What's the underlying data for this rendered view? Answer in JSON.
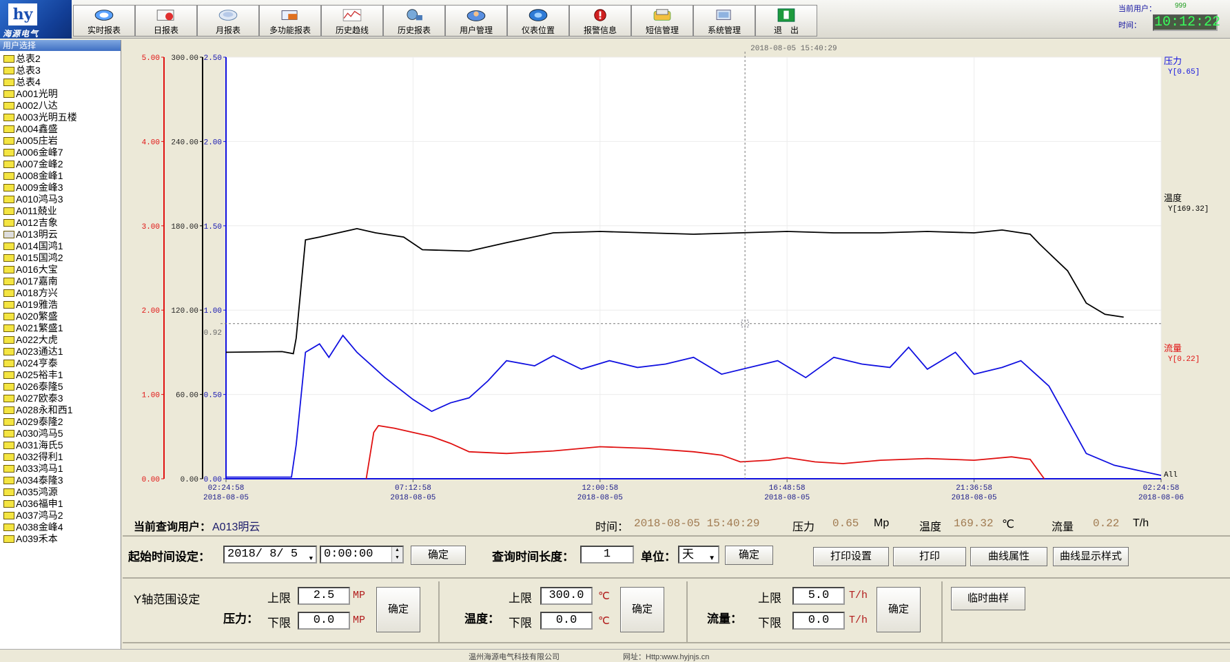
{
  "logo": {
    "mark": "hy",
    "name": "海源电气"
  },
  "toolbar": {
    "buttons": [
      {
        "label": "实时报表",
        "icon": "realtime-report-icon"
      },
      {
        "label": "日报表",
        "icon": "daily-report-icon"
      },
      {
        "label": "月报表",
        "icon": "monthly-report-icon"
      },
      {
        "label": "多功能报表",
        "icon": "multi-report-icon"
      },
      {
        "label": "历史趋线",
        "icon": "history-trend-icon"
      },
      {
        "label": "历史报表",
        "icon": "history-report-icon"
      },
      {
        "label": "用户管理",
        "icon": "user-manage-icon"
      },
      {
        "label": "仪表位置",
        "icon": "meter-location-icon"
      },
      {
        "label": "报警信息",
        "icon": "alarm-icon"
      },
      {
        "label": "短信管理",
        "icon": "sms-icon"
      },
      {
        "label": "系统管理",
        "icon": "system-icon"
      },
      {
        "label": "退　出",
        "icon": "exit-icon"
      }
    ]
  },
  "userinfo": {
    "current_user_label": "当前用户：",
    "current_user_value": "999",
    "time_label": "时间：",
    "time_value": "10:12:22"
  },
  "sidebar": {
    "header": "用户选择",
    "items": [
      "总表2",
      "总表3",
      "总表4",
      "A001光明",
      "A002八达",
      "A003光明五楼",
      "A004鑫盛",
      "A005庄岩",
      "A006金峰7",
      "A007金峰2",
      "A008金峰1",
      "A009金峰3",
      "A010鸿马3",
      "A011兢业",
      "A012吉象",
      "A013明云",
      "A014国鸿1",
      "A015国鸿2",
      "A016大宝",
      "A017嘉南",
      "A018方兴",
      "A019雅浩",
      "A020繁盛",
      "A021繁盛1",
      "A022大虎",
      "A023通达1",
      "A024亨泰",
      "A025裕丰1",
      "A026泰隆5",
      "A027欧泰3",
      "A028永和西1",
      "A029泰隆2",
      "A030鸿马5",
      "A031海氏5",
      "A032得利1",
      "A033鸿马1",
      "A034泰隆3",
      "A035鸿源",
      "A036福申1",
      "A037鸿马2",
      "A038金峰4",
      "A039禾本"
    ],
    "selected_index": 15
  },
  "chart_data": {
    "type": "line",
    "x": [
      "02:24:58",
      "07:12:58",
      "12:00:58",
      "16:48:58",
      "21:36:58",
      "02:24:58"
    ],
    "x_dates": [
      "2018-08-05",
      "2018-08-05",
      "2018-08-05",
      "2018-08-05",
      "2018-08-05",
      "2018-08-06"
    ],
    "cursor_label": "2018-08-05 15:40:29",
    "cursor_y_label": "0.92",
    "axes": [
      {
        "name": "流量",
        "color": "#e01010",
        "ylim": [
          0,
          5
        ],
        "ticks": [
          "0.00",
          "1.00",
          "2.00",
          "3.00",
          "4.00",
          "5.00"
        ]
      },
      {
        "name": "温度",
        "color": "#000000",
        "ylim": [
          0,
          300
        ],
        "ticks": [
          "0.00",
          "60.00",
          "120.00",
          "180.00",
          "240.00",
          "300.00"
        ]
      },
      {
        "name": "压力",
        "color": "#1010e0",
        "ylim": [
          0,
          2.5
        ],
        "ticks": [
          "0.00",
          "0.50",
          "1.00",
          "1.50",
          "2.00",
          "2.50"
        ]
      }
    ],
    "labels": {
      "pressure": "压力",
      "pressure_y": "Y[0.65]",
      "temperature": "温度",
      "temperature_y": "Y[169.32]",
      "flow": "流量",
      "flow_y": "Y[0.22]",
      "all": "All"
    },
    "series": [
      {
        "name": "温度",
        "color": "#000000",
        "axis": 1,
        "points": [
          [
            0,
            90
          ],
          [
            0.06,
            90.5
          ],
          [
            0.072,
            89
          ],
          [
            0.075,
            100
          ],
          [
            0.085,
            170
          ],
          [
            0.1,
            172
          ],
          [
            0.12,
            175
          ],
          [
            0.14,
            178
          ],
          [
            0.16,
            175
          ],
          [
            0.19,
            172
          ],
          [
            0.21,
            163
          ],
          [
            0.26,
            162
          ],
          [
            0.3,
            168
          ],
          [
            0.35,
            175
          ],
          [
            0.4,
            176
          ],
          [
            0.45,
            175
          ],
          [
            0.5,
            174
          ],
          [
            0.55,
            175
          ],
          [
            0.6,
            176
          ],
          [
            0.65,
            175
          ],
          [
            0.7,
            175
          ],
          [
            0.75,
            176
          ],
          [
            0.8,
            175
          ],
          [
            0.83,
            177
          ],
          [
            0.86,
            174
          ],
          [
            0.87,
            167
          ],
          [
            0.9,
            148
          ],
          [
            0.92,
            125
          ],
          [
            0.94,
            117
          ],
          [
            0.96,
            115
          ]
        ]
      },
      {
        "name": "压力",
        "color": "#1010e0",
        "axis": 2,
        "points": [
          [
            0,
            0.01
          ],
          [
            0.07,
            0.01
          ],
          [
            0.075,
            0.2
          ],
          [
            0.085,
            0.75
          ],
          [
            0.1,
            0.8
          ],
          [
            0.11,
            0.72
          ],
          [
            0.125,
            0.85
          ],
          [
            0.14,
            0.75
          ],
          [
            0.17,
            0.6
          ],
          [
            0.2,
            0.47
          ],
          [
            0.22,
            0.4
          ],
          [
            0.24,
            0.45
          ],
          [
            0.26,
            0.48
          ],
          [
            0.28,
            0.58
          ],
          [
            0.3,
            0.7
          ],
          [
            0.33,
            0.67
          ],
          [
            0.35,
            0.73
          ],
          [
            0.38,
            0.65
          ],
          [
            0.41,
            0.7
          ],
          [
            0.44,
            0.66
          ],
          [
            0.47,
            0.68
          ],
          [
            0.5,
            0.72
          ],
          [
            0.53,
            0.62
          ],
          [
            0.56,
            0.66
          ],
          [
            0.59,
            0.7
          ],
          [
            0.62,
            0.6
          ],
          [
            0.65,
            0.72
          ],
          [
            0.68,
            0.68
          ],
          [
            0.71,
            0.66
          ],
          [
            0.73,
            0.78
          ],
          [
            0.75,
            0.65
          ],
          [
            0.78,
            0.75
          ],
          [
            0.8,
            0.62
          ],
          [
            0.83,
            0.66
          ],
          [
            0.85,
            0.7
          ],
          [
            0.87,
            0.6
          ],
          [
            0.88,
            0.55
          ],
          [
            0.9,
            0.35
          ],
          [
            0.92,
            0.15
          ],
          [
            0.95,
            0.08
          ],
          [
            1,
            0.02
          ]
        ]
      },
      {
        "name": "流量",
        "color": "#e01010",
        "axis": 0,
        "points": [
          [
            0.15,
            0.0
          ],
          [
            0.158,
            0.55
          ],
          [
            0.163,
            0.63
          ],
          [
            0.18,
            0.6
          ],
          [
            0.2,
            0.55
          ],
          [
            0.22,
            0.5
          ],
          [
            0.24,
            0.42
          ],
          [
            0.26,
            0.32
          ],
          [
            0.3,
            0.3
          ],
          [
            0.35,
            0.33
          ],
          [
            0.4,
            0.38
          ],
          [
            0.45,
            0.36
          ],
          [
            0.5,
            0.32
          ],
          [
            0.53,
            0.28
          ],
          [
            0.55,
            0.2
          ],
          [
            0.58,
            0.22
          ],
          [
            0.6,
            0.25
          ],
          [
            0.63,
            0.2
          ],
          [
            0.66,
            0.18
          ],
          [
            0.7,
            0.22
          ],
          [
            0.75,
            0.24
          ],
          [
            0.8,
            0.22
          ],
          [
            0.84,
            0.26
          ],
          [
            0.86,
            0.23
          ],
          [
            0.875,
            0.0
          ]
        ]
      }
    ]
  },
  "info": {
    "query_user_label": "当前查询用户：",
    "query_user_value": "A013明云",
    "time_label": "时间：",
    "time_value": "2018-08-05 15:40:29",
    "pressure_label": "压力",
    "pressure_value": "0.65",
    "pressure_unit": "Mp",
    "temp_label": "温度",
    "temp_value": "169.32",
    "temp_unit": "℃",
    "flow_label": "流量",
    "flow_value": "0.22",
    "flow_unit": "T/h"
  },
  "controls": {
    "start_label": "起始时间设定：",
    "start_date": "2018/ 8/ 5",
    "start_time": "0:00:00",
    "confirm": "确定",
    "duration_label": "查询时间长度：",
    "duration_value": "1",
    "unit_label": "单位：",
    "unit_value": "天",
    "print_setup": "打印设置",
    "print": "打印",
    "curve_props": "曲线属性",
    "curve_style": "曲线显示样式",
    "yrange_label": "Y轴范围设定",
    "upper": "上限",
    "lower": "下限",
    "pressure_label": "压力：",
    "pressure_upper": "2.5",
    "pressure_lower": "0.0",
    "pressure_unit": "MP",
    "temp_label": "温度：",
    "temp_upper": "300.0",
    "temp_lower": "0.0",
    "temp_unit": "℃",
    "flow_label": "流量：",
    "flow_upper": "5.0",
    "flow_lower": "0.0",
    "flow_unit": "T/h",
    "temp_curve": "临时曲样"
  },
  "status": {
    "company": "温州海源电气科技有限公司",
    "website": "网址：Http:www.hyjnjs.cn"
  }
}
